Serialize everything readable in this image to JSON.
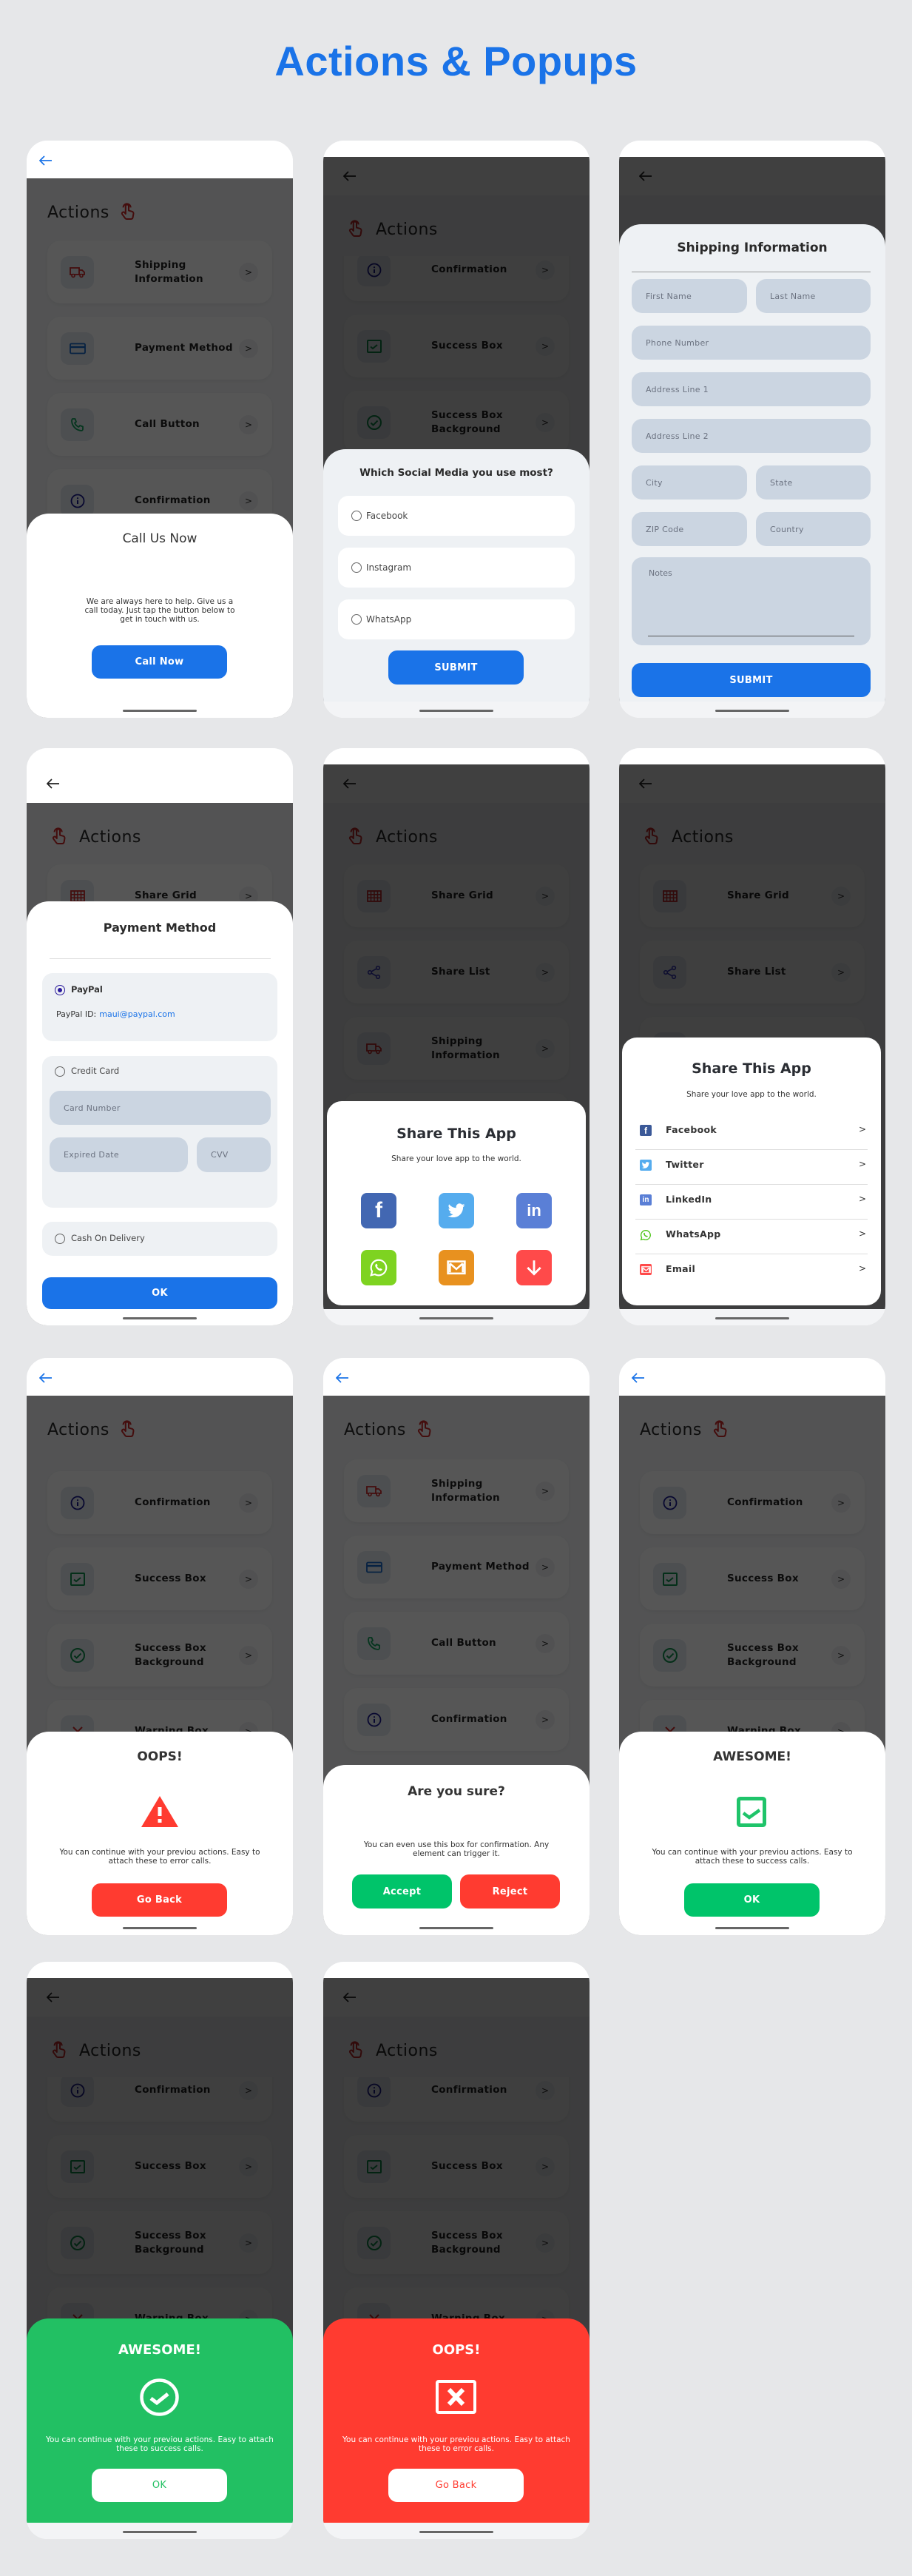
{
  "page": {
    "title": "Actions & Popups"
  },
  "colors": {
    "background": "#e6e7e9",
    "accent": "#1a73e8",
    "success": "#00c46a",
    "danger": "#ff3b30",
    "field": "#cbd5e1",
    "sheet_alt": "#eef1f4"
  },
  "screens": [
    {
      "list_title": "Actions",
      "list": [
        {
          "label": "Shipping Information",
          "icon": "truck-icon"
        },
        {
          "label": "Payment Method",
          "icon": "credit-card-icon"
        },
        {
          "label": "Call Button",
          "icon": "phone-icon"
        },
        {
          "label": "Confirmation",
          "icon": "info-icon"
        }
      ],
      "sheet": {
        "type": "call",
        "title": "Call Us Now",
        "body": "We are always here to help. Give us a call today. Just tap the button below to get in touch with us.",
        "button": "Call Now"
      }
    },
    {
      "list_title": "Actions",
      "list": [
        {
          "label": "Confirmation",
          "icon": "info-icon"
        },
        {
          "label": "Success Box",
          "icon": "check-square-icon"
        },
        {
          "label": "Success Box Background",
          "icon": "check-circle-icon"
        }
      ],
      "sheet": {
        "type": "survey",
        "title": "Which Social Media you use most?",
        "options": [
          "Facebook",
          "Instagram",
          "WhatsApp"
        ],
        "button": "SUBMIT"
      }
    },
    {
      "list_title": "",
      "list": [],
      "sheet": {
        "type": "shipping",
        "title": "Shipping Information",
        "fields": {
          "first_name": "First Name",
          "last_name": "Last Name",
          "phone": "Phone Number",
          "address1": "Address  Line 1",
          "address2": "Address  Line 2",
          "city": "City",
          "state": "State",
          "zip": "ZIP Code",
          "country": "Country",
          "notes": "Notes"
        },
        "button": "SUBMIT"
      }
    },
    {
      "list_title": "Actions",
      "list": [
        {
          "label": "Share Grid",
          "icon": "grid-icon"
        }
      ],
      "sheet": {
        "type": "payment",
        "title": "Payment Method",
        "paypal": {
          "label": "PayPal",
          "selected": true,
          "id_label": "PayPal ID:",
          "id_value": "maui@paypal.com"
        },
        "credit_card": {
          "label": "Credit Card",
          "selected": false,
          "card_number": "Card Number",
          "expired_date": "Expired Date",
          "cvv": "CVV"
        },
        "cash": {
          "label": "Cash On Delivery",
          "selected": false
        },
        "button": "OK"
      }
    },
    {
      "list_title": "Actions",
      "list": [
        {
          "label": "Share Grid",
          "icon": "grid-icon"
        },
        {
          "label": "Share List",
          "icon": "share-icon"
        },
        {
          "label": "Shipping Information",
          "icon": "truck-icon"
        }
      ],
      "sheet": {
        "type": "share_grid",
        "title": "Share This App",
        "subtitle": "Share your love app to the world.",
        "items": [
          {
            "icon": "facebook-icon",
            "color": "#4267b2"
          },
          {
            "icon": "twitter-icon",
            "color": "#55acee"
          },
          {
            "icon": "linkedin-icon",
            "color": "#5a7fd6"
          },
          {
            "icon": "whatsapp-icon",
            "color": "#7ed321"
          },
          {
            "icon": "email-icon",
            "color": "#e8911f"
          },
          {
            "icon": "download-icon",
            "color": "#ff4a4a"
          }
        ]
      }
    },
    {
      "list_title": "Actions",
      "list": [
        {
          "label": "Share Grid",
          "icon": "grid-icon"
        },
        {
          "label": "Share List",
          "icon": "share-icon"
        }
      ],
      "sheet": {
        "type": "share_list",
        "title": "Share This App",
        "subtitle": "Share your love app to the world.",
        "items": [
          {
            "label": "Facebook",
            "icon": "facebook-icon",
            "color": "#3b5998"
          },
          {
            "label": "Twitter",
            "icon": "twitter-icon",
            "color": "#55acee"
          },
          {
            "label": "LinkedIn",
            "icon": "linkedin-icon",
            "color": "#5a7fd6"
          },
          {
            "label": "WhatsApp",
            "icon": "whatsapp-icon",
            "color": "#4cc417"
          },
          {
            "label": "Email",
            "icon": "email-icon",
            "color": "#ff4a4a"
          }
        ]
      }
    },
    {
      "list_title": "Actions",
      "list": [
        {
          "label": "Confirmation",
          "icon": "info-icon"
        },
        {
          "label": "Success Box",
          "icon": "check-square-icon"
        },
        {
          "label": "Success Box Background",
          "icon": "check-circle-icon"
        },
        {
          "label": "Warning Box",
          "icon": "x-icon"
        }
      ],
      "sheet": {
        "type": "error",
        "title": "OOPS!",
        "body": "You can continue with your previou actions. Easy to attach these to error calls.",
        "button": "Go Back"
      }
    },
    {
      "list_title": "Actions",
      "list": [
        {
          "label": "Shipping Information",
          "icon": "truck-icon"
        },
        {
          "label": "Payment Method",
          "icon": "credit-card-icon"
        },
        {
          "label": "Call Button",
          "icon": "phone-icon"
        },
        {
          "label": "Confirmation",
          "icon": "info-icon"
        }
      ],
      "sheet": {
        "type": "confirm",
        "title": "Are you sure?",
        "body": "You can even use this box for confirmation. Any element can trigger it.",
        "accept": "Accept",
        "reject": "Reject"
      }
    },
    {
      "list_title": "Actions",
      "list": [
        {
          "label": "Confirmation",
          "icon": "info-icon"
        },
        {
          "label": "Success Box",
          "icon": "check-square-icon"
        },
        {
          "label": "Success Box Background",
          "icon": "check-circle-icon"
        },
        {
          "label": "Warning Box",
          "icon": "x-icon"
        }
      ],
      "sheet": {
        "type": "success",
        "title": "AWESOME!",
        "body": "You can continue with your previou actions. Easy to attach these to success calls.",
        "button": "OK"
      }
    },
    {
      "list_title": "Actions",
      "list": [
        {
          "label": "Confirmation",
          "icon": "info-icon"
        },
        {
          "label": "Success Box",
          "icon": "check-square-icon"
        },
        {
          "label": "Success Box Background",
          "icon": "check-circle-icon"
        },
        {
          "label": "Warning Box",
          "icon": "x-icon"
        }
      ],
      "sheet": {
        "type": "success_bg",
        "title": "AWESOME!",
        "body": "You can continue with your previou actions. Easy to attach these to success calls.",
        "button": "OK",
        "color": "#22c063"
      }
    },
    {
      "list_title": "Actions",
      "list": [
        {
          "label": "Confirmation",
          "icon": "info-icon"
        },
        {
          "label": "Success Box",
          "icon": "check-square-icon"
        },
        {
          "label": "Success Box Background",
          "icon": "check-circle-icon"
        },
        {
          "label": "Warning Box",
          "icon": "x-icon"
        }
      ],
      "sheet": {
        "type": "error_bg",
        "title": "OOPS!",
        "body": "You can continue with your previou actions. Easy to attach these to error calls.",
        "button": "Go Back",
        "color": "#ff3b30"
      }
    }
  ]
}
